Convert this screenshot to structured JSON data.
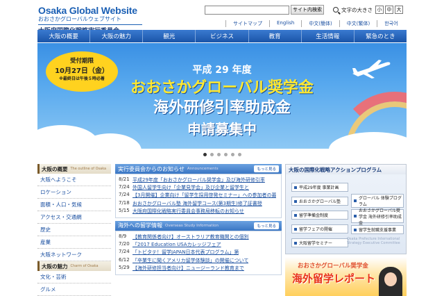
{
  "header": {
    "logo_en": "Osaka Global Website",
    "logo_jp": "おおさかグローバルウェブサイト",
    "logo_org": "大阪府国際化戦略実行委員会",
    "search_button": "サイト内検索",
    "font_size_label": "文字の大きさ",
    "font_sizes": [
      "小",
      "中",
      "大"
    ],
    "util_links": [
      "サイトマップ",
      "English",
      "中文(簡体)",
      "中文(繁体)",
      "한국어"
    ]
  },
  "nav": [
    "大阪の概要",
    "大阪の魅力",
    "観光",
    "ビジネス",
    "教育",
    "生活情報",
    "緊急のとき"
  ],
  "hero": {
    "deadline_title": "受付期限",
    "deadline_date": "10月27日（金）",
    "deadline_note": "※最終日は午後５時必着",
    "line1": "平成 29 年度",
    "line2": "おおさかグローバル奨学金",
    "line3": "海外研修引率助成金",
    "line4": "申請募集中",
    "slides": 6,
    "active_slide": 1
  },
  "sidebar": {
    "section1": {
      "title": "大阪の概要",
      "subtitle": "The outline of Osaka",
      "items": [
        "大阪へようこそ",
        "ロケーション",
        "面積・人口・気候",
        "アクセス・交通網",
        "歴史",
        "産業",
        "大阪ネットワーク"
      ]
    },
    "section2": {
      "title": "大阪の魅力",
      "subtitle": "Charm of Osaka",
      "items": [
        "文化・芸術",
        "グルメ"
      ]
    }
  },
  "news": {
    "title": "実行委員会からのお知らせ",
    "subtitle": "Announcements",
    "more": "もっと見る",
    "items": [
      {
        "date": "8/21",
        "text": "平成29年度「おおさかグローバル奨学金」及び海外研修引率"
      },
      {
        "date": "7/24",
        "text": "外国人留学生向け「企業見学会」及び企業と留学生と"
      },
      {
        "date": "7/24",
        "text": "【3月開催】企業向け「留学生採用啓発セミナー」への参加者の募"
      },
      {
        "date": "7/18",
        "text": "おおさかグローバル塾 海外留学コース(第3期生)修了証書授"
      },
      {
        "date": "5/15",
        "text": "大阪府国際化戦略実行委員会事務局移転のお知らせ"
      }
    ]
  },
  "study": {
    "title": "海外への留学情報",
    "subtitle": "Overseas Study Information",
    "more": "もっと見る",
    "items": [
      {
        "date": "8/9",
        "text": "【教育関係者向け】オーストラリア教育機関との個別"
      },
      {
        "date": "7/20",
        "text": "「2017 Education USAカレッジフェア"
      },
      {
        "date": "7/24",
        "text": "「トビタテ！留学JAPAN日本代表プログラム」第"
      },
      {
        "date": "6/12",
        "text": "「卒業生に聞くアメリカ留学体験談」の開催について"
      },
      {
        "date": "5/29",
        "text": "【海外研修担当者向け】ニュージーランド教育まで"
      }
    ]
  },
  "action": {
    "title": "大阪の国際化戦略アクションプログラム",
    "buttons": [
      "平成29年度 事業計画",
      "おおさかグローバル塾",
      "グローバル 体験プログラム",
      "留学準備金制度",
      "おおさかグローバル奨学金 海外研修引率助成金",
      "留学フェアの開催",
      "留学生就職支援事業",
      "大阪留学セミナー"
    ],
    "watermark": "Osaka Prefecture International Strategy Executive Committee"
  },
  "ryugaku": {
    "line1": "おおさかグローバル奨学金",
    "line2": "海外留学レポート"
  }
}
